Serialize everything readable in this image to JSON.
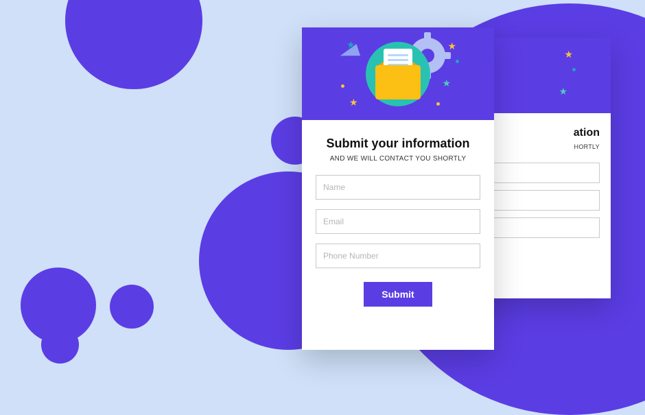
{
  "form": {
    "title": "Submit your information",
    "subtitle": "AND WE WILL CONTACT YOU SHORTLY",
    "name_placeholder": "Name",
    "email_placeholder": "Email",
    "phone_placeholder": "Phone Number",
    "submit_label": "Submit"
  },
  "back_form": {
    "title_visible": "ation",
    "subtitle_visible": "HORTLY"
  }
}
